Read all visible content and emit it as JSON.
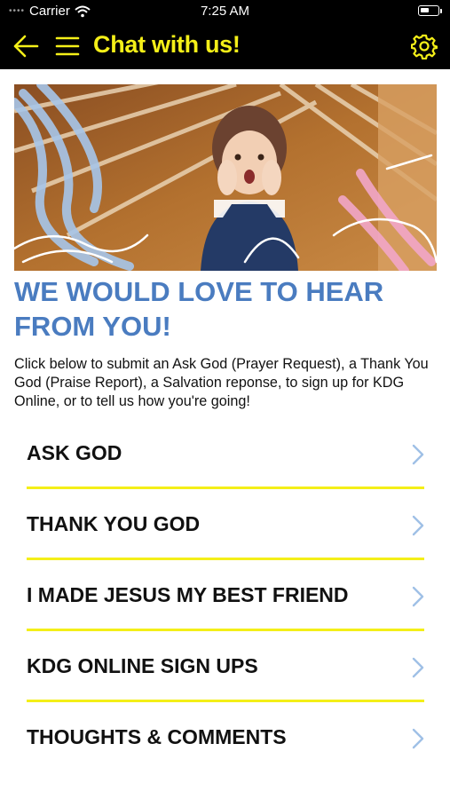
{
  "status_bar": {
    "carrier": "Carrier",
    "time": "7:25 AM"
  },
  "nav": {
    "title": "Chat with us!",
    "accent_color": "#f4ef18"
  },
  "hero": {
    "description": "photo"
  },
  "heading": "WE WOULD LOVE TO HEAR FROM YOU!",
  "intro": "Click below to submit an Ask God (Prayer Request), a Thank You God (Praise Report), a Salvation reponse, to sign up for KDG Online, or to tell us how you're going!",
  "menu_items": [
    {
      "label": "ASK GOD"
    },
    {
      "label": "THANK YOU GOD"
    },
    {
      "label": "I MADE JESUS MY BEST FRIEND"
    },
    {
      "label": "KDG ONLINE SIGN UPS"
    },
    {
      "label": "THOUGHTS & COMMENTS"
    }
  ],
  "colors": {
    "heading": "#4a7cc0",
    "chevron": "#9fc0e6",
    "divider": "#f4ef18"
  }
}
